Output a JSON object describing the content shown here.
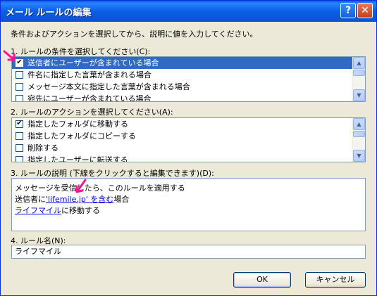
{
  "window": {
    "title": "メール ルールの編集",
    "help_label": "?",
    "close_label": "✕"
  },
  "instruction": "条件およびアクションを選択してから、説明に値を入力してください。",
  "section1": {
    "label": "1. ルールの条件を選択してください(C):",
    "items": [
      {
        "label": "送信者にユーザーが含まれている場合",
        "checked": true,
        "selected": true
      },
      {
        "label": "件名に指定した言葉が含まれる場合",
        "checked": false,
        "selected": false
      },
      {
        "label": "メッセージ本文に指定した言葉が含まれる場合",
        "checked": false,
        "selected": false
      },
      {
        "label": "宛先にユーザーが含まれている場合",
        "checked": false,
        "selected": false
      }
    ]
  },
  "section2": {
    "label": "2. ルールのアクションを選択してください(A):",
    "items": [
      {
        "label": "指定したフォルダに移動する",
        "checked": true
      },
      {
        "label": "指定したフォルダにコピーする",
        "checked": false
      },
      {
        "label": "削除する",
        "checked": false
      },
      {
        "label": "指定したユーザーに転送する",
        "checked": false
      }
    ]
  },
  "section3": {
    "label": "3. ルールの説明 (下線をクリックすると編集できます)(D):",
    "line1": "メッセージを受信したら、このルールを適用する",
    "line2_prefix": "送信者に",
    "line2_link": "'lifemile.jp' を含む",
    "line2_suffix": "場合",
    "line3_link": "ライフマイル",
    "line3_suffix": "に移動する"
  },
  "section4": {
    "label": "4. ルール名(N):",
    "value": "ライフマイル"
  },
  "buttons": {
    "ok": "OK",
    "cancel": "キャンセル"
  },
  "checkmark": "✔",
  "annotation_color": "#ff1493"
}
